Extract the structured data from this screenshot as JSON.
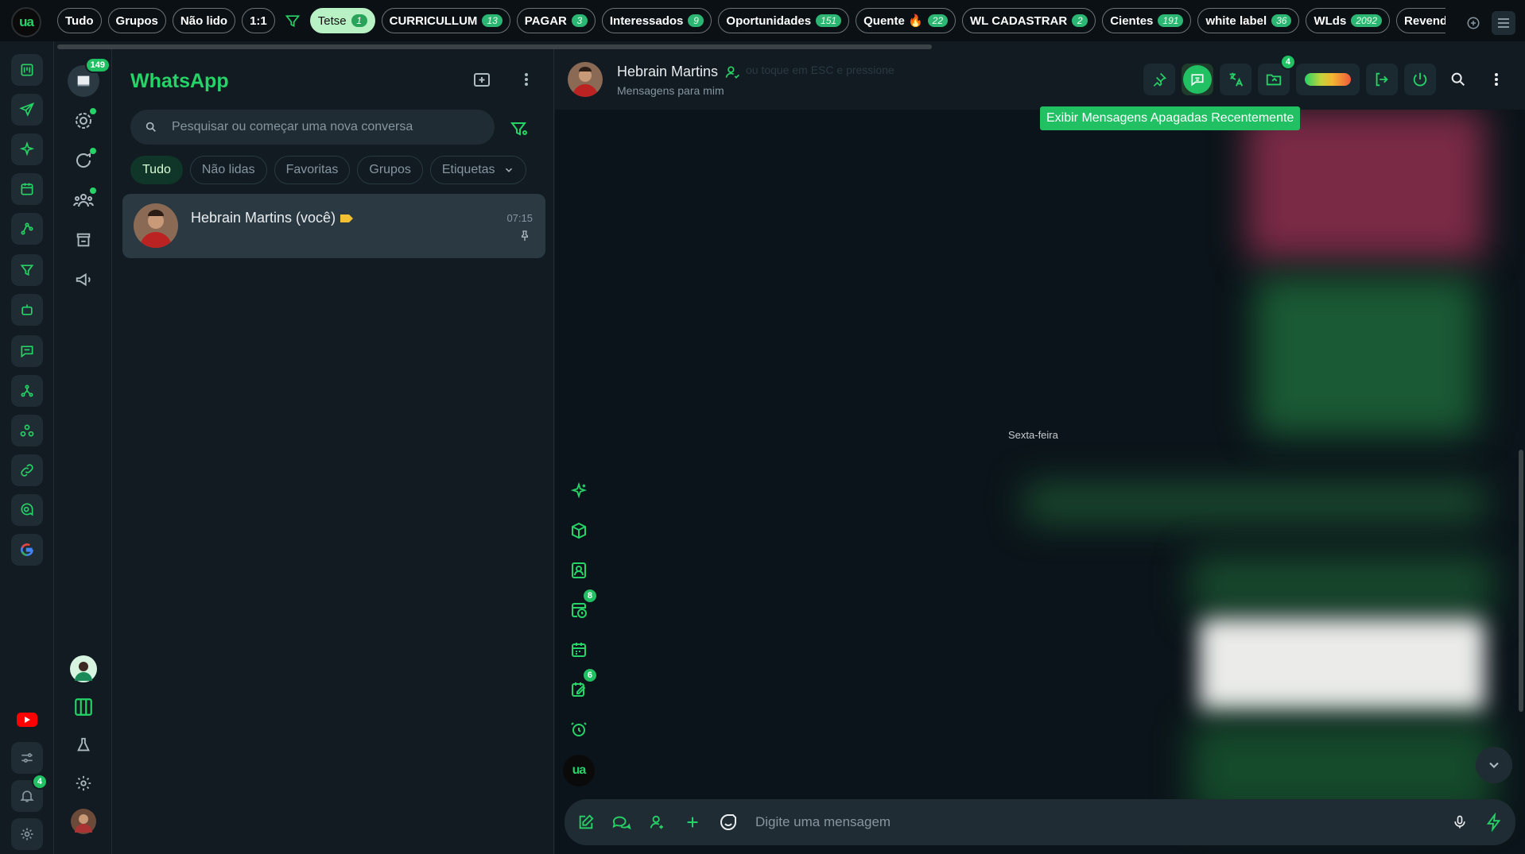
{
  "top_filters": {
    "logo_text": "ua",
    "chips": [
      {
        "label": "Tudo",
        "count": "",
        "active": false
      },
      {
        "label": "Grupos",
        "count": "",
        "active": false
      },
      {
        "label": "Não lido",
        "count": "",
        "active": false
      },
      {
        "label": "1:1",
        "count": "",
        "active": false
      },
      {
        "label": "Tetse",
        "count": "1",
        "active": true
      },
      {
        "label": "CURRICULLUM",
        "count": "13",
        "active": false
      },
      {
        "label": "PAGAR",
        "count": "3",
        "active": false
      },
      {
        "label": "Interessados",
        "count": "9",
        "active": false
      },
      {
        "label": "Oportunidades",
        "count": "151",
        "active": false
      },
      {
        "label": "Quente 🔥",
        "count": "22",
        "active": false
      },
      {
        "label": "WL CADASTRAR",
        "count": "2",
        "active": false
      },
      {
        "label": "Cientes",
        "count": "191",
        "active": false
      },
      {
        "label": "white label",
        "count": "36",
        "active": false
      },
      {
        "label": "WLds",
        "count": "2092",
        "active": false
      },
      {
        "label": "Revenda v",
        "count": "",
        "active": false
      }
    ]
  },
  "rail2": {
    "chats_badge": "149"
  },
  "rail": {
    "notifications_badge": "4"
  },
  "chat_list": {
    "title": "WhatsApp",
    "search_placeholder": "Pesquisar ou começar uma nova conversa",
    "pills": [
      "Tudo",
      "Não lidas",
      "Favoritas",
      "Grupos",
      "Etiquetas"
    ],
    "active_pill": "Tudo",
    "items": [
      {
        "name": "Hebrain Martins (você)",
        "time": "07:15"
      }
    ]
  },
  "conversation": {
    "contact_name": "Hebrain Martins",
    "contact_subtitle": "Mensagens para mim",
    "ghost_hint": "ou toque em ESC e pressione",
    "tooltip": "Exibir Mensagens Apagadas Recentemente",
    "attachments_badge": "4",
    "date_separator": "Sexta-feira",
    "reminders_badge": "8",
    "tasks_badge": "6",
    "composer_placeholder": "Digite uma mensagem",
    "logo_text": "ua"
  },
  "colors": {
    "accent": "#25d366",
    "panel": "#111b21",
    "chat_bg": "#0b141a",
    "active_chip": "#b7f1c4"
  }
}
